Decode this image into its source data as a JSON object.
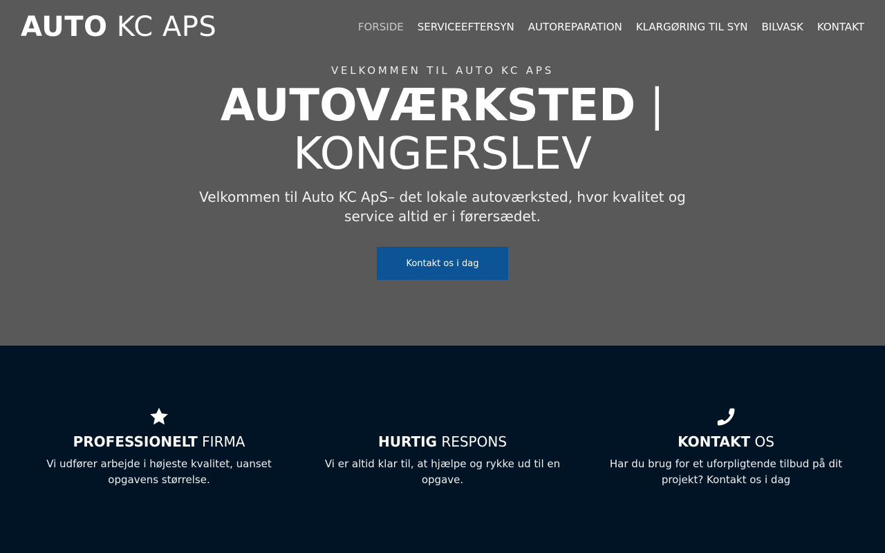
{
  "header": {
    "logo_bold": "AUTO",
    "logo_light": " KC APS",
    "nav": [
      {
        "label": "FORSIDE"
      },
      {
        "label": "SERVICEEFTERSYN"
      },
      {
        "label": "AUTOREPARATION"
      },
      {
        "label": "KLARGØRING TIL SYN"
      },
      {
        "label": "BILVASK"
      },
      {
        "label": "KONTAKT"
      }
    ]
  },
  "hero": {
    "eyebrow": "VELKOMMEN TIL AUTO KC APS",
    "title_strong": "AUTOVÆRKSTED",
    "title_light": " | KONGERSLEV",
    "lead": "Velkommen til Auto KC ApS– det lokale autoværksted, hvor kvalitet og service altid er i førersædet.",
    "cta_label": "Kontakt os i dag"
  },
  "features": [
    {
      "icon": "star-icon",
      "title_strong": "PROFESSIONELT",
      "title_light": " FIRMA",
      "text": "Vi udfører arbejde i højeste kvalitet, uanset opgavens størrelse."
    },
    {
      "icon": "",
      "title_strong": "HURTIG",
      "title_light": " RESPONS",
      "text": "Vi er altid klar til, at hjælpe og rykke ud til en opgave."
    },
    {
      "icon": "phone-icon",
      "title_strong": "KONTAKT",
      "title_light": " OS",
      "text": "Har du brug for et uforpligtende tilbud på dit projekt? Kontakt os i dag"
    }
  ],
  "colors": {
    "hero_bg": "#595959",
    "features_bg": "#011426",
    "cta_bg": "#0c5495",
    "nav_active": "#c9c9c9"
  }
}
